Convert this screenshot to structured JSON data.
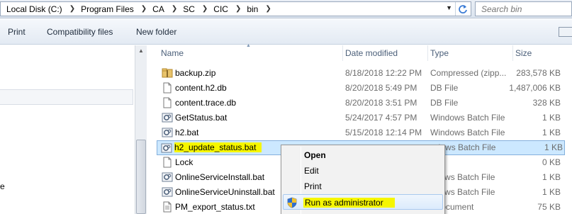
{
  "address": {
    "crumbs": [
      "Local Disk (C:)",
      "Program Files",
      "CA",
      "SC",
      "CIC",
      "bin"
    ],
    "search_placeholder": "Search bin"
  },
  "toolbar": {
    "print": "Print",
    "compat": "Compatibility files",
    "new_folder": "New folder"
  },
  "nav": {
    "partial_text": "e"
  },
  "columns": {
    "name": "Name",
    "date": "Date modified",
    "type": "Type",
    "size": "Size"
  },
  "files": [
    {
      "name": "backup.zip",
      "date": "8/18/2018 12:22 PM",
      "type": "Compressed (zipp...",
      "size": "283,578 KB",
      "icon": "zip-folder-icon"
    },
    {
      "name": "content.h2.db",
      "date": "8/20/2018 5:49 PM",
      "type": "DB File",
      "size": "1,487,006 KB",
      "icon": "file-icon"
    },
    {
      "name": "content.trace.db",
      "date": "8/20/2018 3:51 PM",
      "type": "DB File",
      "size": "328 KB",
      "icon": "file-icon"
    },
    {
      "name": "GetStatus.bat",
      "date": "5/24/2017 4:57 PM",
      "type": "Windows Batch File",
      "size": "1 KB",
      "icon": "batch-file-icon"
    },
    {
      "name": "h2.bat",
      "date": "5/15/2018 12:14 PM",
      "type": "Windows Batch File",
      "size": "1 KB",
      "icon": "batch-file-icon"
    },
    {
      "name": "h2_update_status.bat",
      "date": "",
      "type": "ndows Batch File",
      "size": "1 KB",
      "icon": "batch-file-icon"
    },
    {
      "name": "Lock",
      "date": "",
      "type": "",
      "size": "0 KB",
      "icon": "file-icon"
    },
    {
      "name": "OnlineServiceInstall.bat",
      "date": "",
      "type": "ndows Batch File",
      "size": "1 KB",
      "icon": "batch-file-icon"
    },
    {
      "name": "OnlineServiceUninstall.bat",
      "date": "",
      "type": "ndows Batch File",
      "size": "1 KB",
      "icon": "batch-file-icon"
    },
    {
      "name": "PM_export_status.txt",
      "date": "",
      "type": "t Document",
      "size": "75 KB",
      "icon": "file-icon"
    }
  ],
  "context_menu": {
    "open": "Open",
    "edit": "Edit",
    "print": "Print",
    "run_as_admin": "Run as administrator"
  },
  "colors": {
    "selection_bg": "#cce8ff",
    "highlight_marker": "#f6f600"
  }
}
